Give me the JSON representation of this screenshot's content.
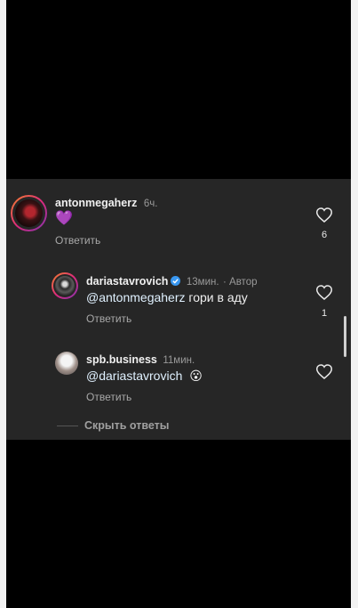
{
  "comments": [
    {
      "username": "antonmegaherz",
      "time": "6ч.",
      "text": "💜",
      "reply_label": "Ответить",
      "like_count": "6"
    },
    {
      "username": "dariastavrovich",
      "time": "13мин.",
      "author_badge": "· Автор",
      "mention": "@antonmegaherz",
      "text": " гори в аду",
      "reply_label": "Ответить",
      "like_count": "1"
    },
    {
      "username": "spb.business",
      "time": "11мин.",
      "mention": "@dariastavrovich",
      "emoji": "😮",
      "reply_label": "Ответить"
    }
  ],
  "hide_replies_label": "Скрыть ответы",
  "icons": [
    "heart-icon",
    "verified-badge-icon"
  ],
  "colors": {
    "panel": "#262626",
    "mention": "#e0f1ff",
    "verified": "#3897f0"
  }
}
